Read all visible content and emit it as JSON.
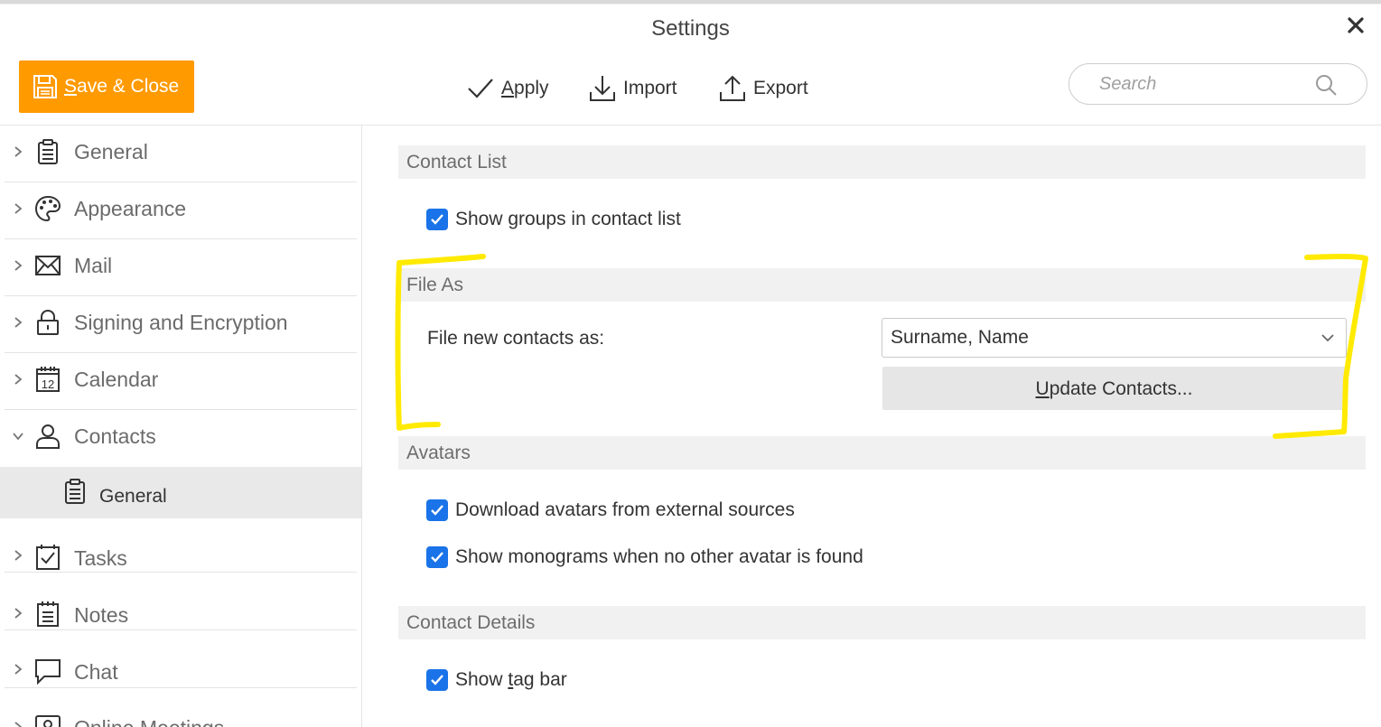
{
  "window": {
    "title": "Settings",
    "close_glyph": "✕"
  },
  "toolbar": {
    "save_close": {
      "underline": "S",
      "rest": "ave & Close",
      "icon": "save-icon"
    },
    "apply": {
      "underline": "A",
      "rest": "pply",
      "icon": "checkmark-icon"
    },
    "import": "Import",
    "export": "Export",
    "search_placeholder": "Search"
  },
  "sidebar": {
    "items": [
      {
        "label": "General",
        "icon": "clipboard-icon",
        "expanded": false
      },
      {
        "label": "Appearance",
        "icon": "palette-icon",
        "expanded": false
      },
      {
        "label": "Mail",
        "icon": "envelope-icon",
        "expanded": false
      },
      {
        "label": "Signing and Encryption",
        "icon": "lock-icon",
        "expanded": false
      },
      {
        "label": "Calendar",
        "icon": "calendar-icon",
        "calendar_day": "12",
        "expanded": false
      },
      {
        "label": "Contacts",
        "icon": "person-icon",
        "expanded": true
      },
      {
        "label": "Tasks",
        "icon": "task-checkbox-icon",
        "expanded": false
      },
      {
        "label": "Notes",
        "icon": "notes-icon",
        "expanded": false
      },
      {
        "label": "Chat",
        "icon": "chat-bubble-icon",
        "expanded": false
      },
      {
        "label": "Online Meetings",
        "icon": "meeting-icon",
        "expanded": false
      }
    ],
    "contacts_sub": {
      "label": "General",
      "icon": "clipboard-icon",
      "selected": true
    }
  },
  "content": {
    "contact_list": {
      "header": "Contact List",
      "show_groups": {
        "label": "Show groups in contact list",
        "checked": true
      }
    },
    "file_as": {
      "header": "File As",
      "label": "File new contacts as:",
      "selected": "Surname, Name",
      "update_btn": {
        "underline": "U",
        "rest": "pdate Contacts..."
      }
    },
    "avatars": {
      "header": "Avatars",
      "download": {
        "label": "Download avatars from external sources",
        "checked": true
      },
      "monograms": {
        "label": "Show monograms when no other avatar is found",
        "checked": true
      }
    },
    "contact_details": {
      "header": "Contact Details",
      "tag_bar": {
        "before": "Show ",
        "underline": "t",
        "after": "ag bar",
        "checked": true
      }
    }
  },
  "colors": {
    "accent_orange": "#ff9a00",
    "checkbox_blue": "#1a73e8",
    "highlight_yellow": "#ffea00",
    "section_bg": "#f1f1f1",
    "selected_bg": "#e9e9e9"
  }
}
